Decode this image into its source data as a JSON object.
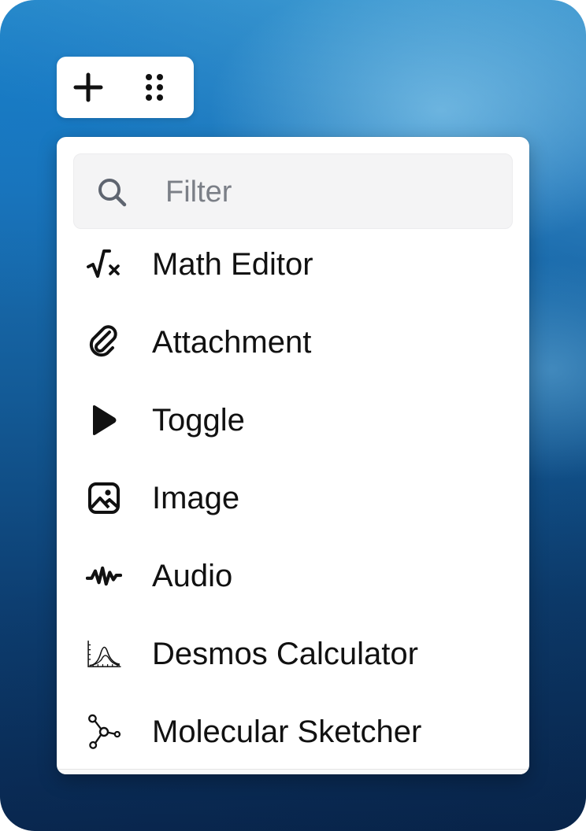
{
  "toolbar": {
    "add_icon": "plus-icon",
    "drag_icon": "drag-handle-icon"
  },
  "filter": {
    "placeholder": "Filter",
    "value": "",
    "icon": "search-icon"
  },
  "menu": {
    "items": [
      {
        "label": "Math Editor",
        "icon": "square-root-icon"
      },
      {
        "label": "Attachment",
        "icon": "paperclip-icon"
      },
      {
        "label": "Toggle",
        "icon": "play-triangle-icon"
      },
      {
        "label": "Image",
        "icon": "image-icon"
      },
      {
        "label": "Audio",
        "icon": "waveform-icon"
      },
      {
        "label": "Desmos Calculator",
        "icon": "graph-curve-icon"
      },
      {
        "label": "Molecular Sketcher",
        "icon": "molecule-icon"
      }
    ]
  },
  "colors": {
    "text": "#111111",
    "placeholder": "#7b7f87",
    "filter_bg": "#f4f4f5",
    "menu_bg": "#ffffff"
  }
}
